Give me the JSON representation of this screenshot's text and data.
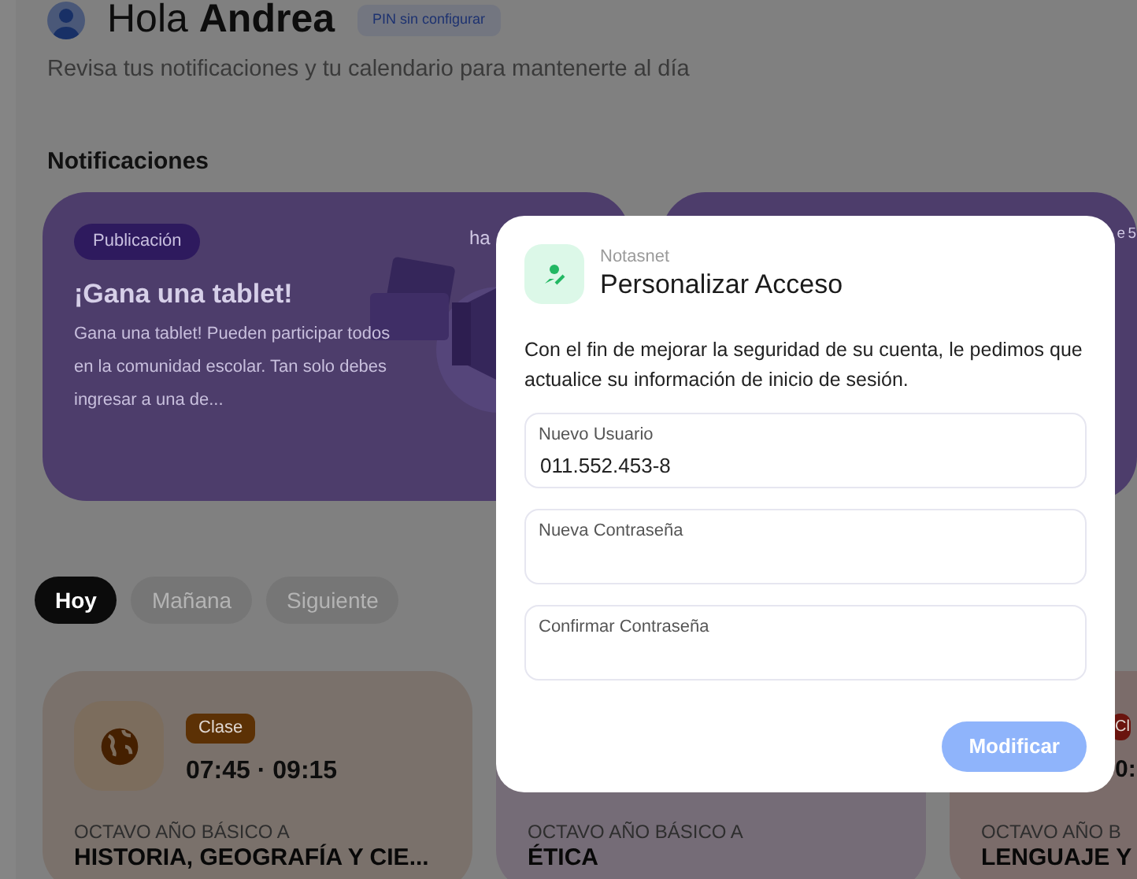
{
  "header": {
    "greeting": "Hola **Andrea**",
    "pin_badge": "PIN sin configurar",
    "subtitle": "Revisa tus notificaciones y tu calendario para mantenerte al día"
  },
  "notifications": {
    "title": "Notificaciones",
    "cards": [
      {
        "tag": "Publicación",
        "time": "ha",
        "title": "¡Gana una tablet!",
        "body": "Gana una tablet! Pueden participar todos en la comunidad escolar. Tan solo debes ingresar a una de..."
      },
      {
        "time": "e 5"
      }
    ]
  },
  "day_tabs": [
    {
      "label": "Hoy",
      "selected": true
    },
    {
      "label": "Mañana",
      "selected": false
    },
    {
      "label": "Siguiente",
      "selected": false
    }
  ],
  "classes": [
    {
      "color": "#7a716b",
      "tag": {
        "text": "Clase",
        "color": "#5c3105"
      },
      "time": "07:45 · 09:15",
      "course": "OCTAVO AÑO BÁSICO A",
      "subject": "HISTORIA, GEOGRAFÍA Y CIE..."
    },
    {
      "color": "#756c77",
      "course": "OCTAVO AÑO BÁSICO A",
      "subject": "ÉTICA"
    },
    {
      "color": "#7b6c6a",
      "tag": {
        "text": "Cl",
        "color": "#6a140e"
      },
      "time": "0:",
      "course": "OCTAVO AÑO B",
      "subject": "LENGUAJE Y"
    }
  ],
  "dialog": {
    "app": "Notasnet",
    "title": "Personalizar Acceso",
    "message": "Con el fin de mejorar la seguridad de su cuenta, le pedimos que actualice su información de inicio de sesión.",
    "fields": [
      {
        "label": "Nuevo Usuario",
        "value": "011.552.453-8"
      },
      {
        "label": "Nueva Contraseña"
      },
      {
        "label": "Confirmar Contraseña"
      }
    ],
    "button": {
      "label": "Modificar",
      "disabled": true
    }
  }
}
